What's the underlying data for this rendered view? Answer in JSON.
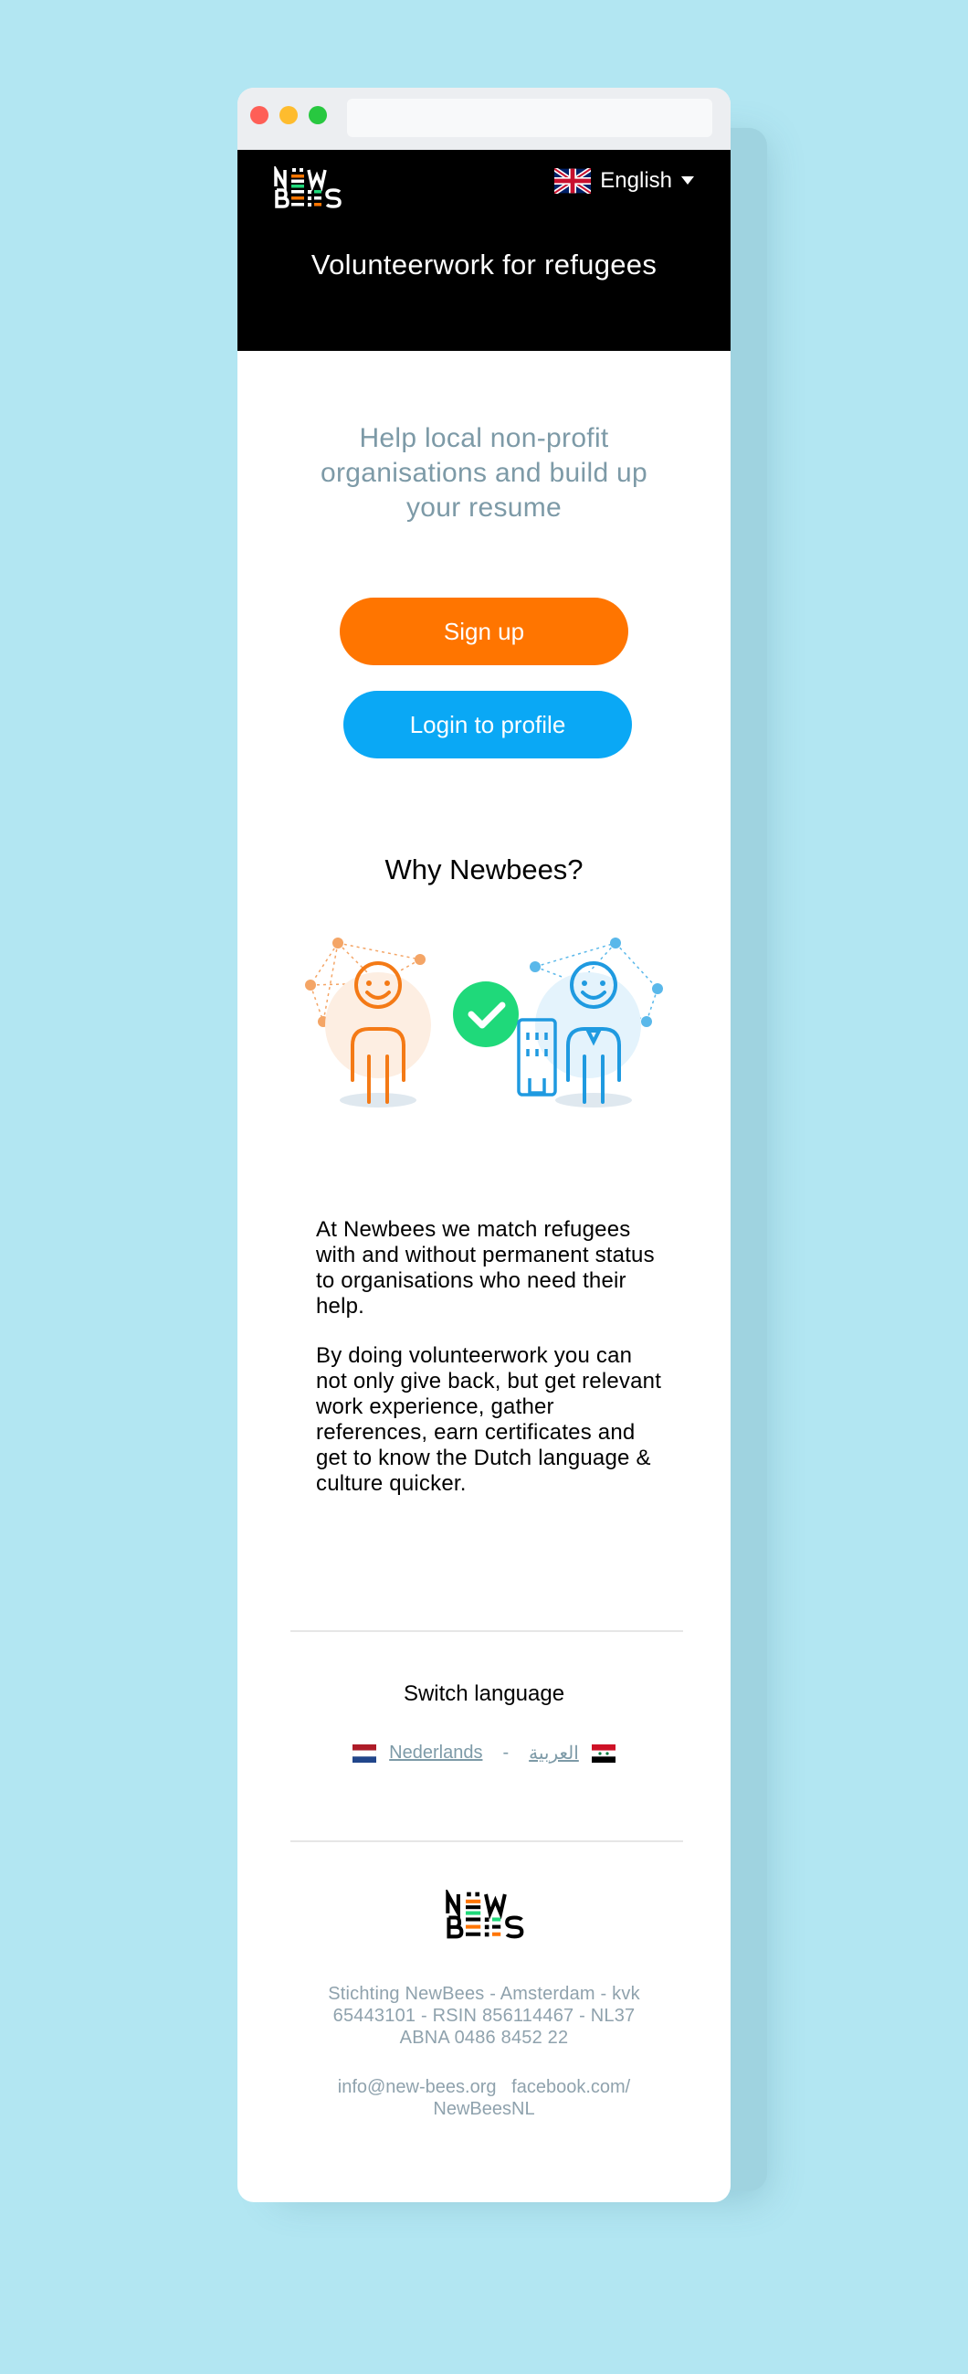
{
  "header": {
    "logo_alt": "NewBees",
    "language": "English",
    "title": "Volunteerwork for refugees"
  },
  "hero": {
    "tagline": "Help local non-profit organisations and build up your resume",
    "signup_label": "Sign up",
    "login_label": "Login to profile"
  },
  "why": {
    "title": "Why Newbees?",
    "paragraph1": "At Newbees we match refugees with and without permanent status to organisations who need their help.",
    "paragraph2": "By doing volunteerwork you can not only give back, but get relevant work experience, gather references, earn certificates and get to know the Dutch language & culture quicker."
  },
  "switch_language": {
    "title": "Switch language",
    "options": [
      "Nederlands",
      "العربية"
    ],
    "separator": "-"
  },
  "footer": {
    "info": "Stichting NewBees - Amsterdam - kvk 65443101 - RSIN 856114467 - NL37 ABNA 0486 8452 22",
    "email": "info@new-bees.org",
    "facebook": "facebook.com/ NewBeesNL"
  },
  "colors": {
    "background": "#b2e6f2",
    "signup": "#ff7500",
    "login": "#0aa8f5",
    "check": "#1fd97a",
    "muted_text": "#7d9aa7"
  },
  "icons": [
    "uk-flag-icon",
    "caret-down-icon",
    "checkmark-icon",
    "netherlands-flag-icon",
    "syria-flag-icon"
  ]
}
